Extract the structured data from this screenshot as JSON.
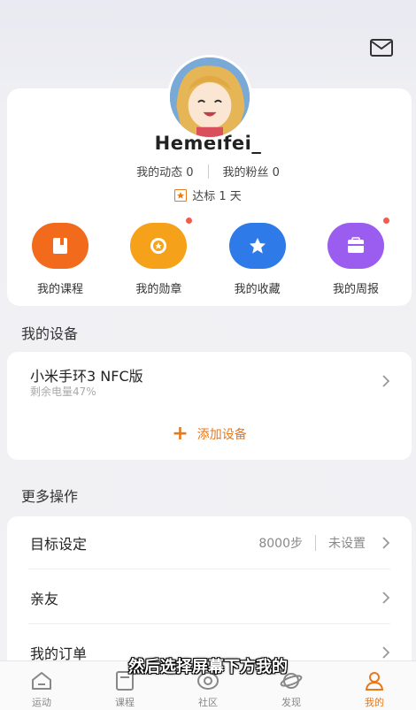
{
  "header": {
    "mail_icon": "mail-icon"
  },
  "profile": {
    "username": "Hemeifei_",
    "dynamics_label": "我的动态",
    "dynamics_count": "0",
    "fans_label": "我的粉丝",
    "fans_count": "0",
    "goal_text": "达标 1 天"
  },
  "quick_actions": [
    {
      "label": "我的课程",
      "color": "#f26a1b",
      "icon": "book-icon",
      "badge": false
    },
    {
      "label": "我的勋章",
      "color": "#f6a11a",
      "icon": "medal-icon",
      "badge": true
    },
    {
      "label": "我的收藏",
      "color": "#2e7ae8",
      "icon": "star-icon",
      "badge": false
    },
    {
      "label": "我的周报",
      "color": "#9b5cf0",
      "icon": "report-icon",
      "badge": true
    }
  ],
  "devices_section": {
    "title": "我的设备",
    "device_name": "小米手环3 NFC版",
    "battery": "剩余电量47%",
    "add_label": "添加设备"
  },
  "more_section": {
    "title": "更多操作",
    "rows": [
      {
        "label": "目标设定",
        "value": "8000步",
        "value2": "未设置"
      },
      {
        "label": "亲友"
      },
      {
        "label": "我的订单"
      }
    ]
  },
  "subtitle": "然后选择屏幕下方我的",
  "tabs": [
    {
      "label": "运动",
      "icon": "house-icon"
    },
    {
      "label": "课程",
      "icon": "course-icon"
    },
    {
      "label": "社区",
      "icon": "eye-icon"
    },
    {
      "label": "发现",
      "icon": "planet-icon"
    },
    {
      "label": "我的",
      "icon": "profile-icon",
      "active": true
    }
  ],
  "accent_color": "#e9781a"
}
